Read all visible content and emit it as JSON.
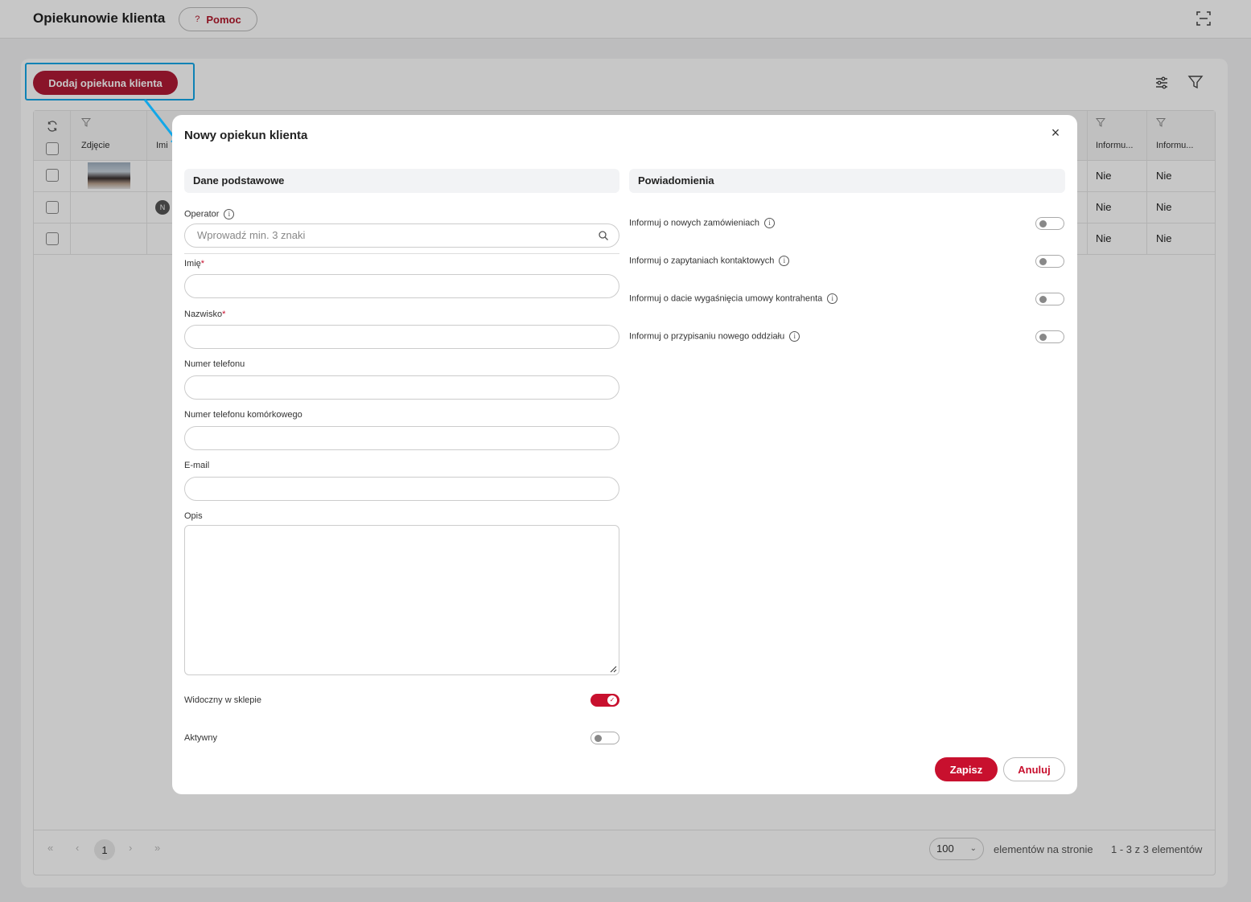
{
  "header": {
    "title": "Opiekunowie klienta",
    "help_label": "Pomoc",
    "help_icon": "?"
  },
  "toolbar": {
    "add_label": "Dodaj opiekuna klienta"
  },
  "grid": {
    "columns": [
      "Zdjęcie",
      "Imi",
      "Informu...",
      "Informu..."
    ],
    "rows": [
      {
        "col1": "Nie",
        "col2": "Nie"
      },
      {
        "col1": "Nie",
        "col2": "Nie",
        "avatar": "N"
      },
      {
        "col1": "Nie",
        "col2": "Nie"
      }
    ],
    "pager": {
      "first": "«",
      "prev": "‹",
      "page": "1",
      "next": "›",
      "last": "»",
      "page_size": "100",
      "per_page_label": "elementów na stronie",
      "count_label": "1 - 3 z 3 elementów"
    }
  },
  "modal": {
    "title": "Nowy opiekun klienta",
    "close_glyph": "×",
    "basic_section": "Dane podstawowe",
    "notif_section": "Powiadomienia",
    "operator_label": "Operator",
    "operator_placeholder": "Wprowadź min. 3 znaki",
    "first_name_label": "Imię",
    "last_name_label": "Nazwisko",
    "required_mark": "*",
    "phone_label": "Numer telefonu",
    "mobile_label": "Numer telefonu komórkowego",
    "email_label": "E-mail",
    "description_label": "Opis",
    "visible_label": "Widoczny w sklepie",
    "visible_on": true,
    "active_label": "Aktywny",
    "active_on": false,
    "notifications": [
      {
        "label": "Informuj o nowych zamówieniach",
        "on": false
      },
      {
        "label": "Informuj o zapytaniach kontaktowych",
        "on": false
      },
      {
        "label": "Informuj o dacie wygaśnięcia umowy kontrahenta",
        "on": false
      },
      {
        "label": "Informuj o przypisaniu nowego oddziału",
        "on": false
      }
    ],
    "save_label": "Zapisz",
    "cancel_label": "Anuluj"
  },
  "colors": {
    "accent": "#c8102e",
    "add_button": "#b01a35",
    "highlight": "#12a7e8"
  }
}
